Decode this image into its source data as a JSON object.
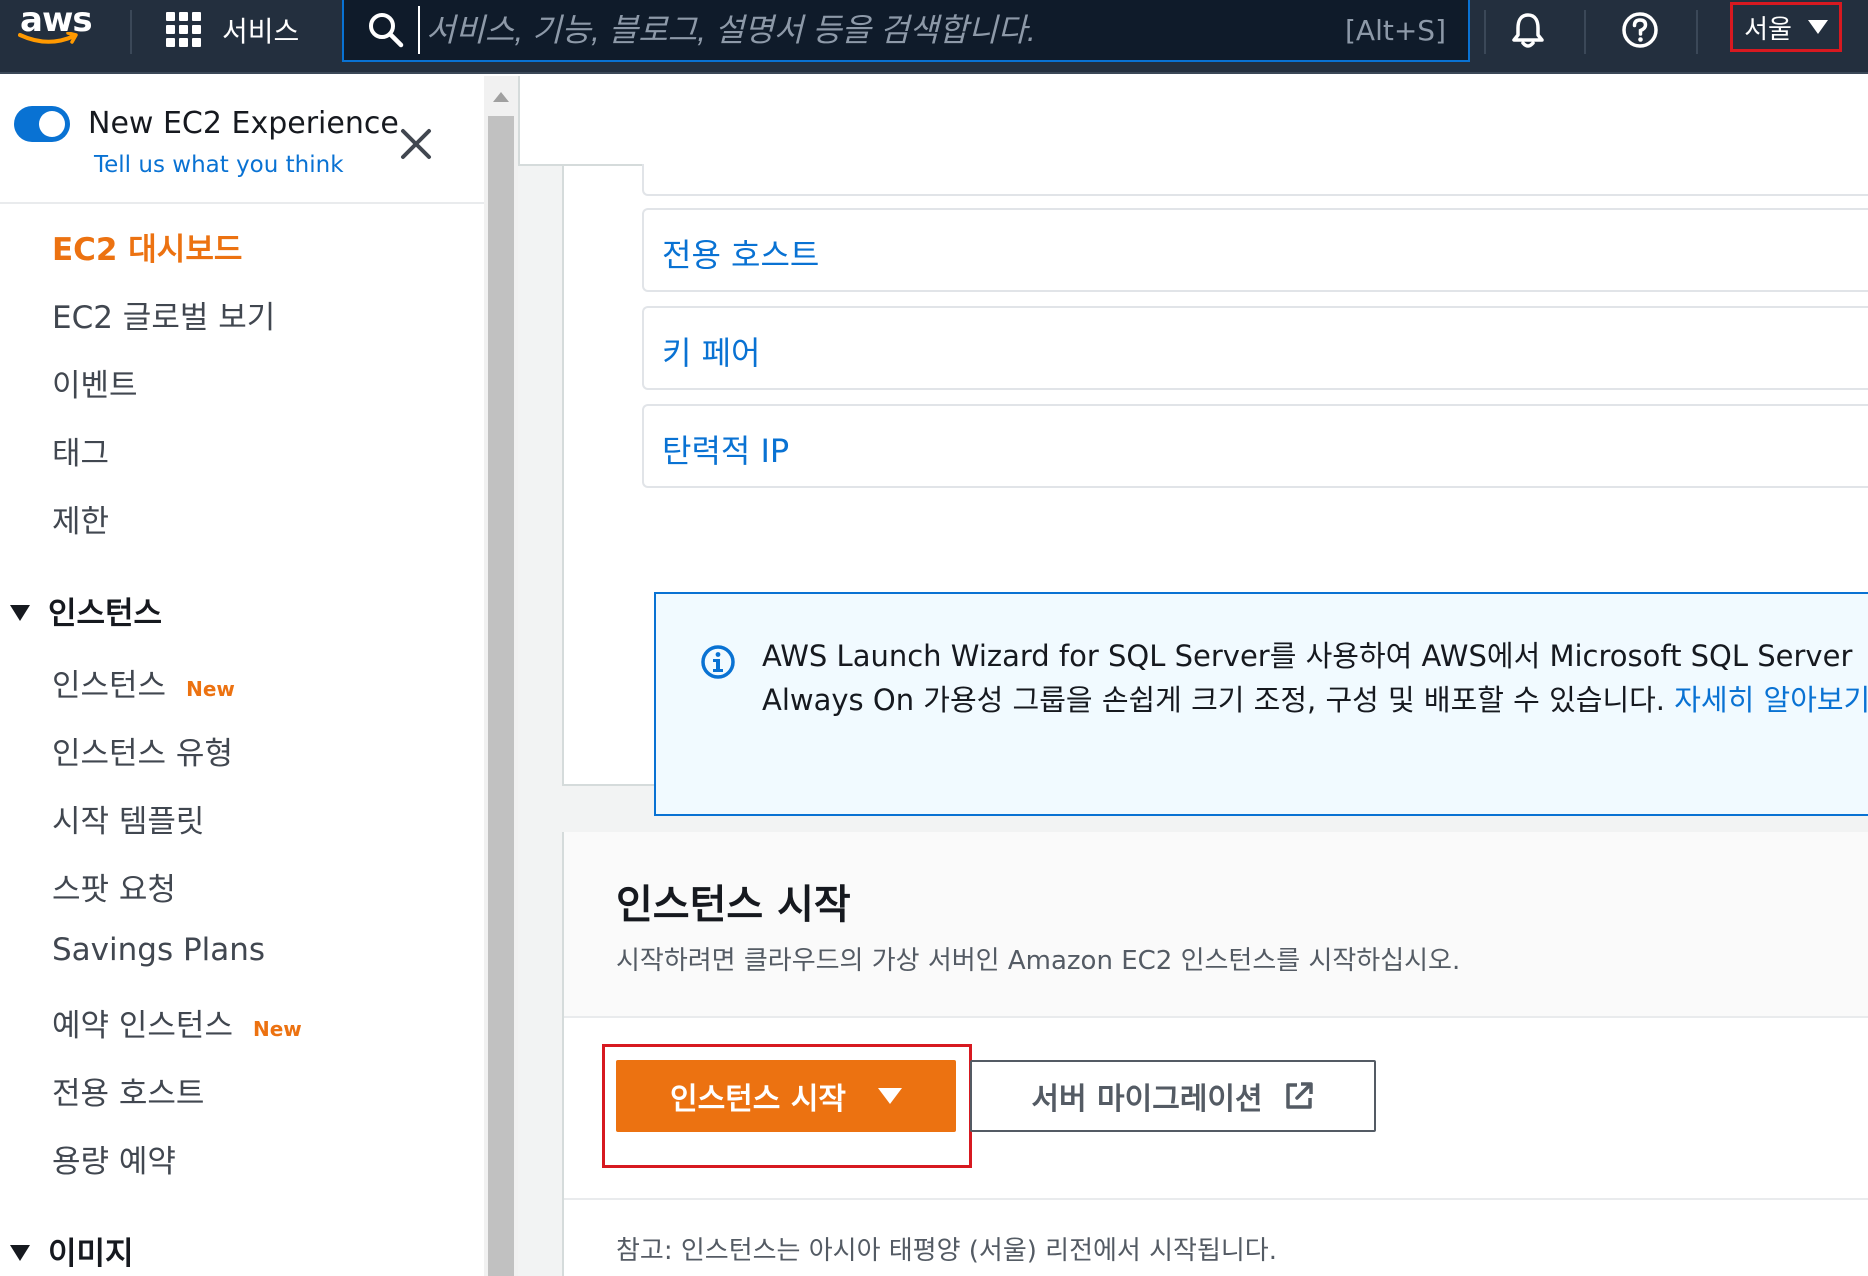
{
  "topnav": {
    "logo_text": "aws",
    "services_label": "서비스",
    "search_placeholder": "서비스, 기능, 블로그, 설명서 등을 검색합니다.",
    "search_shortcut": "[Alt+S]",
    "region_label": "서울",
    "highlight_color": "#d71920"
  },
  "sidebar": {
    "experience_title": "New EC2 Experience",
    "experience_link": "Tell us what you think",
    "items": [
      {
        "label": "EC2 대시보드",
        "active": true
      },
      {
        "label": "EC2 글로벌 보기"
      },
      {
        "label": "이벤트"
      },
      {
        "label": "태그"
      },
      {
        "label": "제한"
      }
    ],
    "sections": [
      {
        "label": "인스턴스",
        "items": [
          {
            "label": "인스턴스",
            "badge": "New"
          },
          {
            "label": "인스턴스 유형"
          },
          {
            "label": "시작 템플릿"
          },
          {
            "label": "스팟 요청"
          },
          {
            "label": "Savings Plans"
          },
          {
            "label": "예약 인스턴스",
            "badge": "New"
          },
          {
            "label": "전용 호스트"
          },
          {
            "label": "용량 예약"
          }
        ]
      },
      {
        "label": "이미지"
      }
    ]
  },
  "resources": {
    "links": [
      "전용 호스트",
      "키 페어",
      "탄력적 IP"
    ]
  },
  "info": {
    "text": "AWS Launch Wizard for SQL Server를 사용하여 AWS에서 Microsoft SQL Server Always On 가용성 그룹을 손쉽게 크기 조정, 구성 및 배포할 수 있습니다. ",
    "link": "자세히 알아보기"
  },
  "launch": {
    "title": "인스턴스 시작",
    "subtitle": "시작하려면 클라우드의 가상 서버인 Amazon EC2 인스턴스를 시작하십시오.",
    "launch_button": "인스턴스 시작",
    "migrate_button": "서버 마이그레이션",
    "note": "참고: 인스턴스는 아시아 태평양 (서울) 리전에서 시작됩니다."
  },
  "colors": {
    "nav_bg": "#232f3e",
    "accent_orange": "#ec7211",
    "link_blue": "#0972d3"
  }
}
